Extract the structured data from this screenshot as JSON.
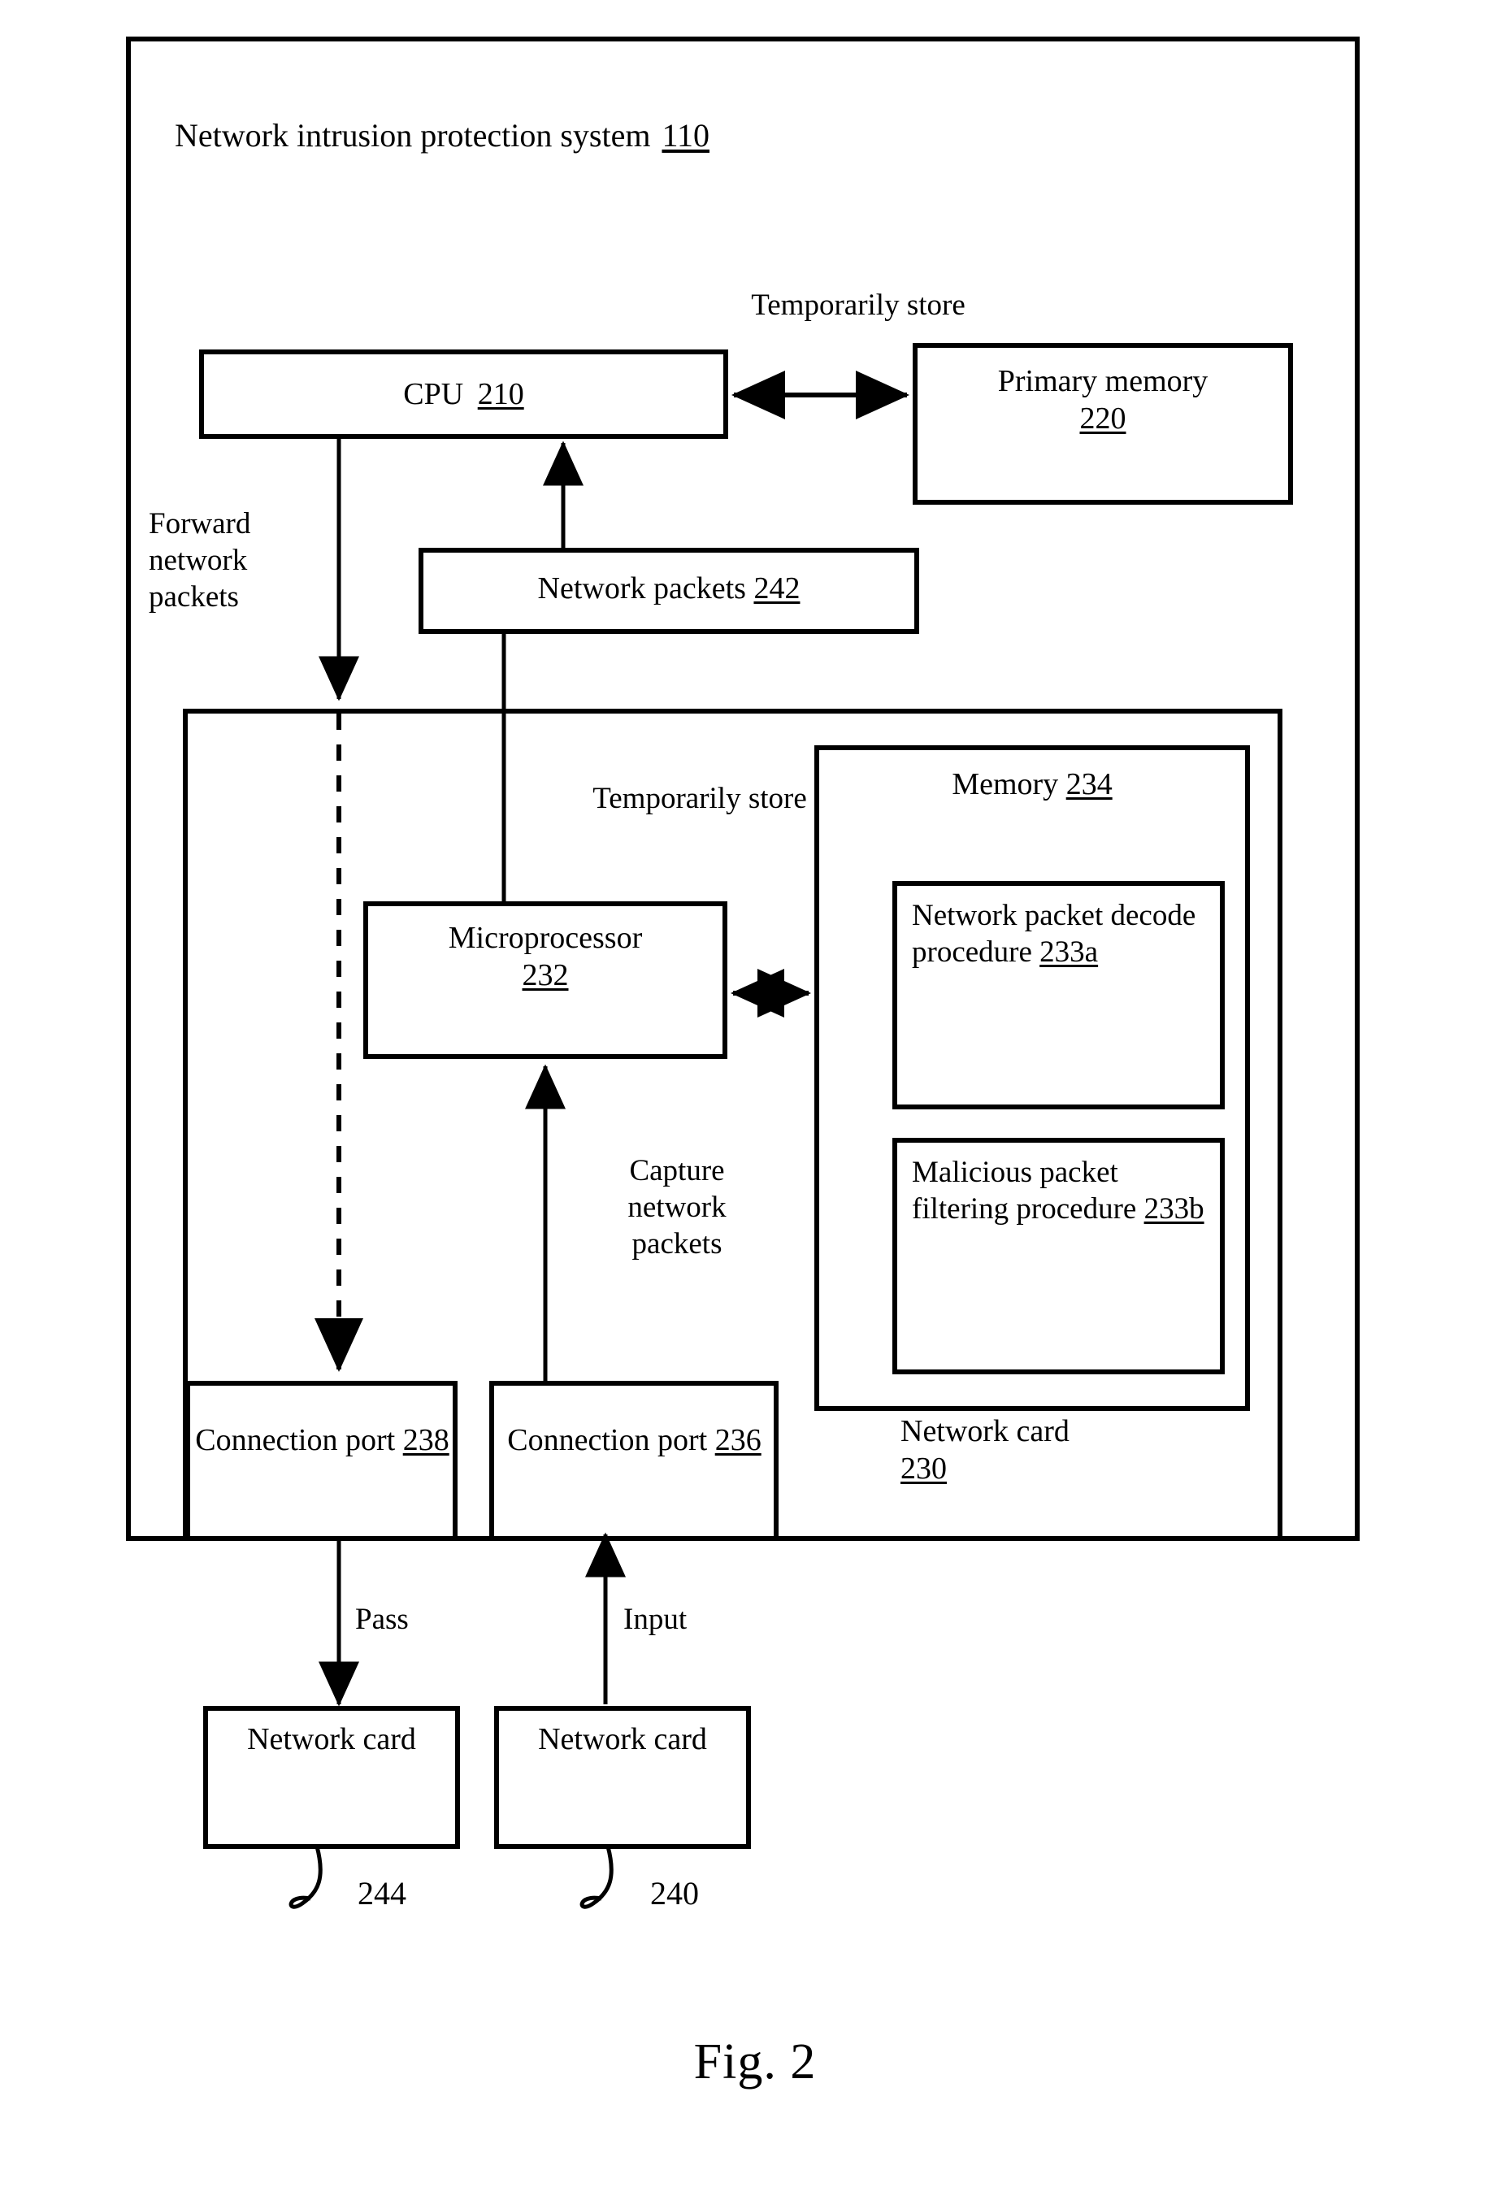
{
  "figure": {
    "caption": "Fig. 2",
    "system_title": "Network intrusion protection system",
    "system_ref": "110"
  },
  "boxes": {
    "cpu": {
      "label": "CPU ",
      "ref": "210"
    },
    "primary_memory": {
      "label": "Primary memory",
      "ref": "220"
    },
    "network_packets": {
      "label": "Network packets ",
      "ref": "242"
    },
    "microprocessor": {
      "label": "Microprocessor",
      "ref": "232"
    },
    "memory": {
      "label": "Memory ",
      "ref": "234"
    },
    "decode_proc": {
      "label": "Network packet decode procedure ",
      "ref": "233a"
    },
    "filter_proc": {
      "label": "Malicious packet filtering procedure ",
      "ref": "233b"
    },
    "conn_port_238": {
      "label": "Connection port ",
      "ref": "238"
    },
    "conn_port_236": {
      "label": "Connection port ",
      "ref": "236"
    },
    "network_card_outer": {
      "label": "Network card",
      "ref": "230"
    },
    "network_card_244": {
      "label": "Network card",
      "ref": "244"
    },
    "network_card_240": {
      "label": "Network card",
      "ref": "240"
    }
  },
  "edge_labels": {
    "temporarily_store_top": "Temporarily store",
    "temporarily_store_inner": "Temporarily store",
    "forward_network_packets": "Forward network packets",
    "capture_network_packets": "Capture network packets",
    "pass": "Pass",
    "input": "Input"
  },
  "colors": {
    "line": "#000000",
    "background": "#ffffff",
    "text": "#000000"
  }
}
